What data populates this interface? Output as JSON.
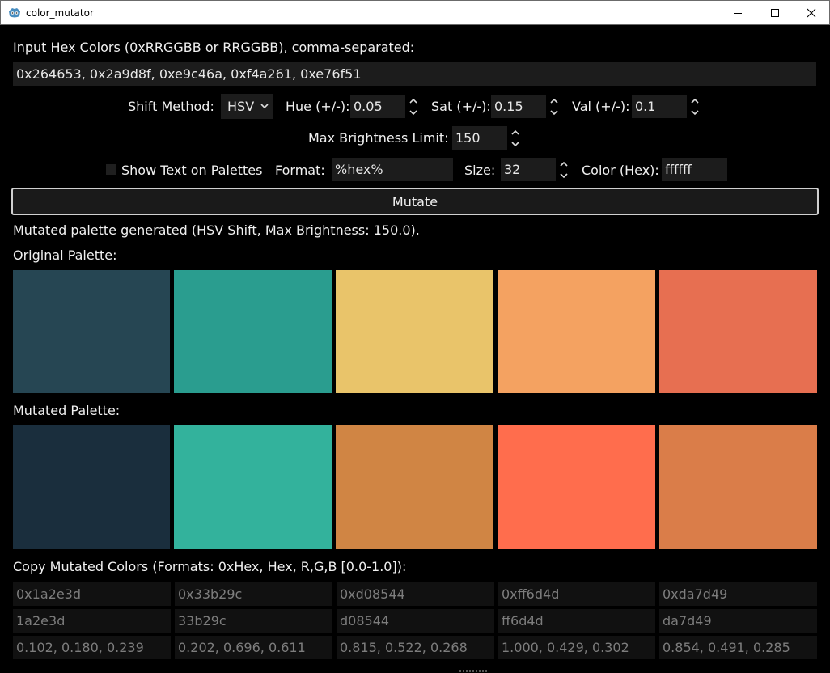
{
  "window": {
    "title": "color_mutator"
  },
  "input": {
    "label": "Input Hex Colors (0xRRGGBB or RRGGBB), comma-separated:",
    "value": "0x264653, 0x2a9d8f, 0xe9c46a, 0xf4a261, 0xe76f51"
  },
  "shift": {
    "method_label": "Shift Method:",
    "method_value": "HSV",
    "hue_label": "Hue (+/-):",
    "hue_value": "0.05",
    "sat_label": "Sat (+/-):",
    "sat_value": "0.15",
    "val_label": "Val (+/-):",
    "val_value": "0.1"
  },
  "brightness": {
    "label": "Max Brightness Limit:",
    "value": "150"
  },
  "text_options": {
    "show_text_label": "Show Text on Palettes",
    "show_text_checked": false,
    "format_label": "Format:",
    "format_value": "%hex%",
    "size_label": "Size:",
    "size_value": "32",
    "color_label": "Color (Hex):",
    "color_value": "ffffff"
  },
  "mutate_button": "Mutate",
  "status": "Mutated palette generated (HSV Shift, Max Brightness: 150.0).",
  "original_palette": {
    "label": "Original Palette:",
    "colors": [
      "#264653",
      "#2a9d8f",
      "#e9c46a",
      "#f4a261",
      "#e76f51"
    ]
  },
  "mutated_palette": {
    "label": "Mutated Palette:",
    "colors": [
      "#1a2e3d",
      "#33b29c",
      "#d08544",
      "#ff6d4d",
      "#da7d49"
    ]
  },
  "copy": {
    "label": "Copy Mutated Colors (Formats: 0xHex, Hex, R,G,B [0.0-1.0]):",
    "hex0x": [
      "0x1a2e3d",
      "0x33b29c",
      "0xd08544",
      "0xff6d4d",
      "0xda7d49"
    ],
    "hex": [
      "1a2e3d",
      "33b29c",
      "d08544",
      "ff6d4d",
      "da7d49"
    ],
    "rgb": [
      "0.102, 0.180, 0.239",
      "0.202, 0.696, 0.611",
      "0.815, 0.522, 0.268",
      "1.000, 0.429, 0.302",
      "0.854, 0.491, 0.285"
    ]
  }
}
